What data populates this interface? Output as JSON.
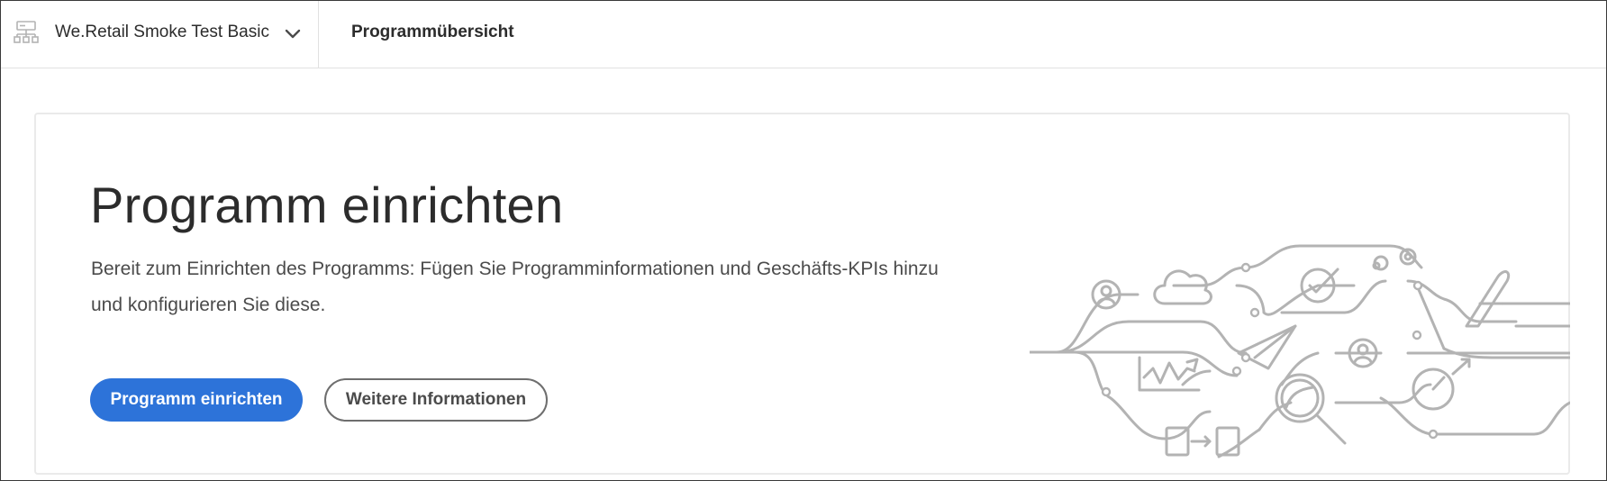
{
  "header": {
    "program_name": "We.Retail Smoke Test Basic",
    "page_title": "Programmübersicht"
  },
  "card": {
    "title": "Programm einrichten",
    "description": "Bereit zum Einrichten des Programms: Fügen Sie Programminformationen und Geschäfts-KPIs hinzu und konfigurieren Sie diese.",
    "primary_button": "Programm einrichten",
    "secondary_button": "Weitere Informationen"
  },
  "colors": {
    "accent": "#2d73d9",
    "illustration_stroke": "#b3b3b3"
  },
  "icons": {
    "program": "server-network-icon",
    "dropdown": "chevron-down-icon"
  }
}
